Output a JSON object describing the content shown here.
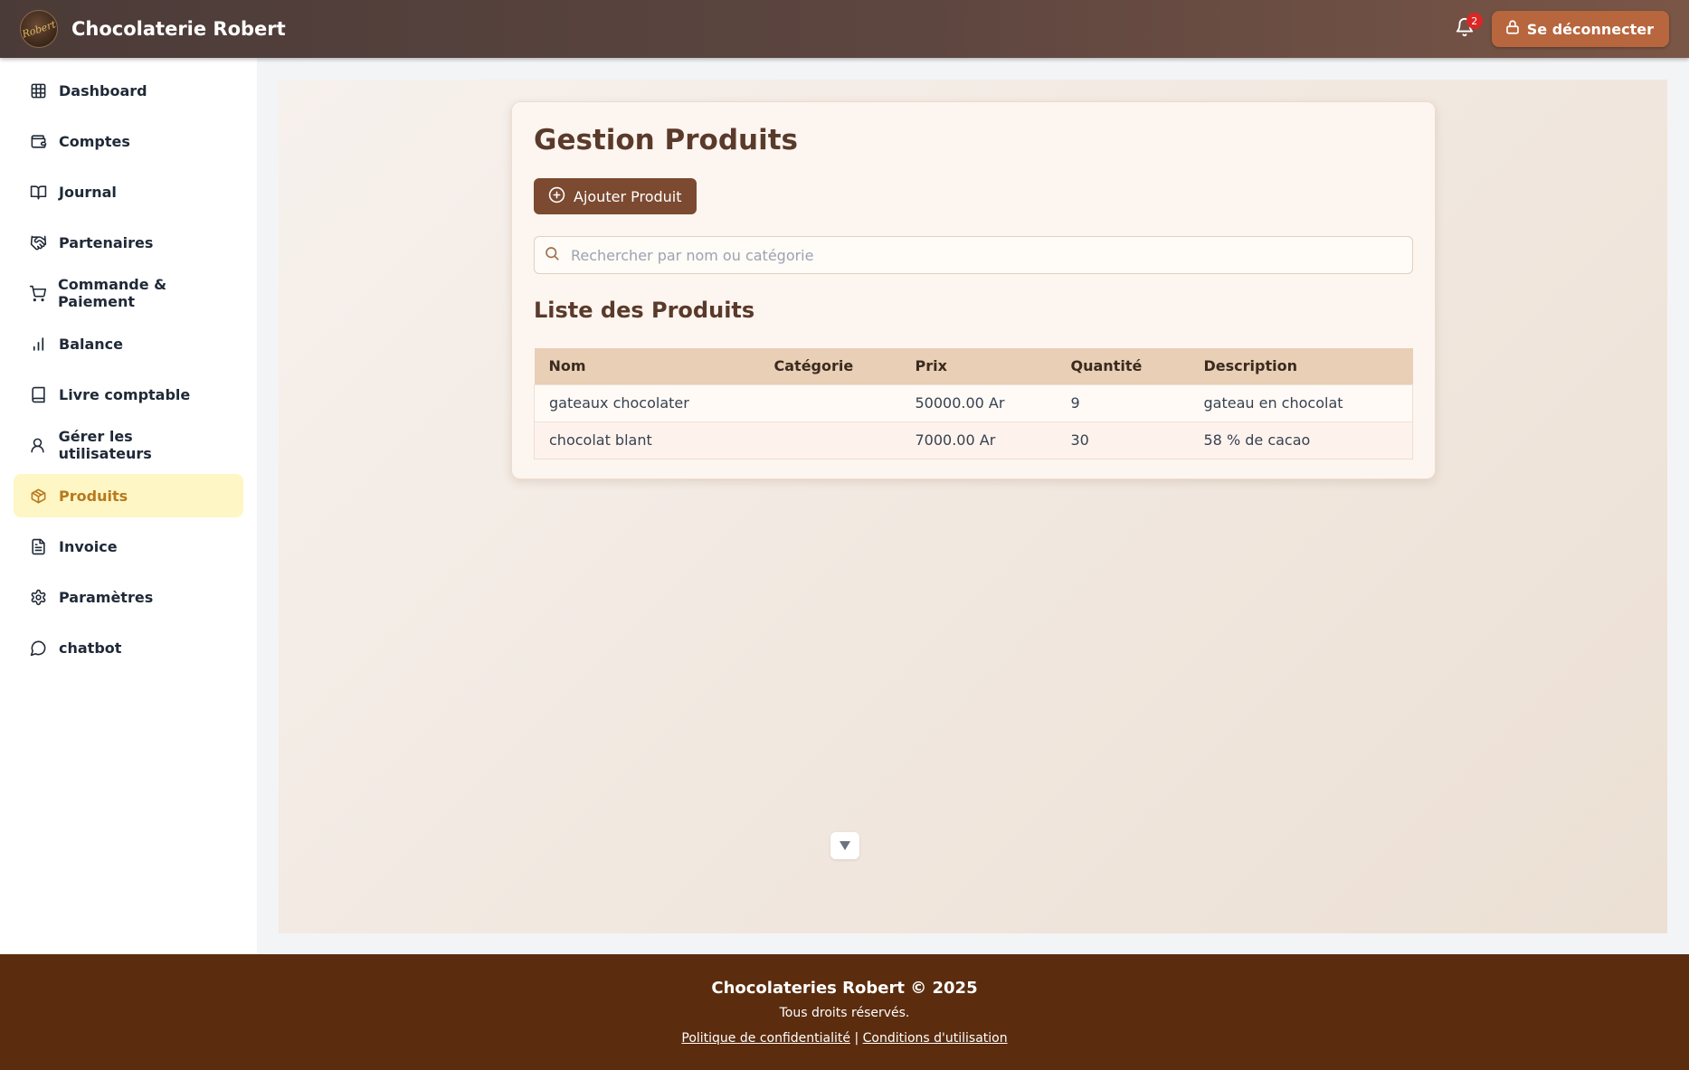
{
  "header": {
    "logo_text": "Robert",
    "brand": "Chocolaterie Robert",
    "notification_count": "2",
    "logout_label": "Se déconnecter"
  },
  "sidebar": {
    "items": [
      {
        "label": "Dashboard",
        "icon": "grid-icon"
      },
      {
        "label": "Comptes",
        "icon": "wallet-icon"
      },
      {
        "label": "Journal",
        "icon": "book-open-icon"
      },
      {
        "label": "Partenaires",
        "icon": "handshake-icon"
      },
      {
        "label": "Commande & Paiement",
        "icon": "cart-icon"
      },
      {
        "label": "Balance",
        "icon": "bar-chart-icon"
      },
      {
        "label": "Livre comptable",
        "icon": "book-icon"
      },
      {
        "label": "Gérer les utilisateurs",
        "icon": "user-icon"
      },
      {
        "label": "Produits",
        "icon": "package-icon",
        "active": true
      },
      {
        "label": "Invoice",
        "icon": "file-text-icon"
      },
      {
        "label": "Paramètres",
        "icon": "gear-icon"
      },
      {
        "label": "chatbot",
        "icon": "chat-icon"
      }
    ]
  },
  "main": {
    "title": "Gestion Produits",
    "add_button": "Ajouter Produit",
    "search_placeholder": "Rechercher par nom ou catégorie",
    "list_title": "Liste des Produits",
    "table": {
      "headers": [
        "Nom",
        "Catégorie",
        "Prix",
        "Quantité",
        "Description"
      ],
      "rows": [
        [
          "gateaux chocolater",
          "",
          "50000.00 Ar",
          "9",
          "gateau en chocolat"
        ],
        [
          "chocolat blant",
          "",
          "7000.00 Ar",
          "30",
          "58 % de cacao"
        ]
      ]
    }
  },
  "footer": {
    "title": "Chocolateries Robert © 2025",
    "rights": "Tous droits réservés.",
    "privacy": "Politique de confidentialité",
    "separator": "|",
    "terms": "Conditions d'utilisation"
  },
  "colors": {
    "header": "#5e4640",
    "logout": "#b8663e",
    "add_button": "#7b4a30",
    "active_nav_bg": "#fef6c4",
    "active_nav_text": "#b7791f",
    "table_header": "#e8cfb5",
    "footer": "#5b2c0e"
  }
}
